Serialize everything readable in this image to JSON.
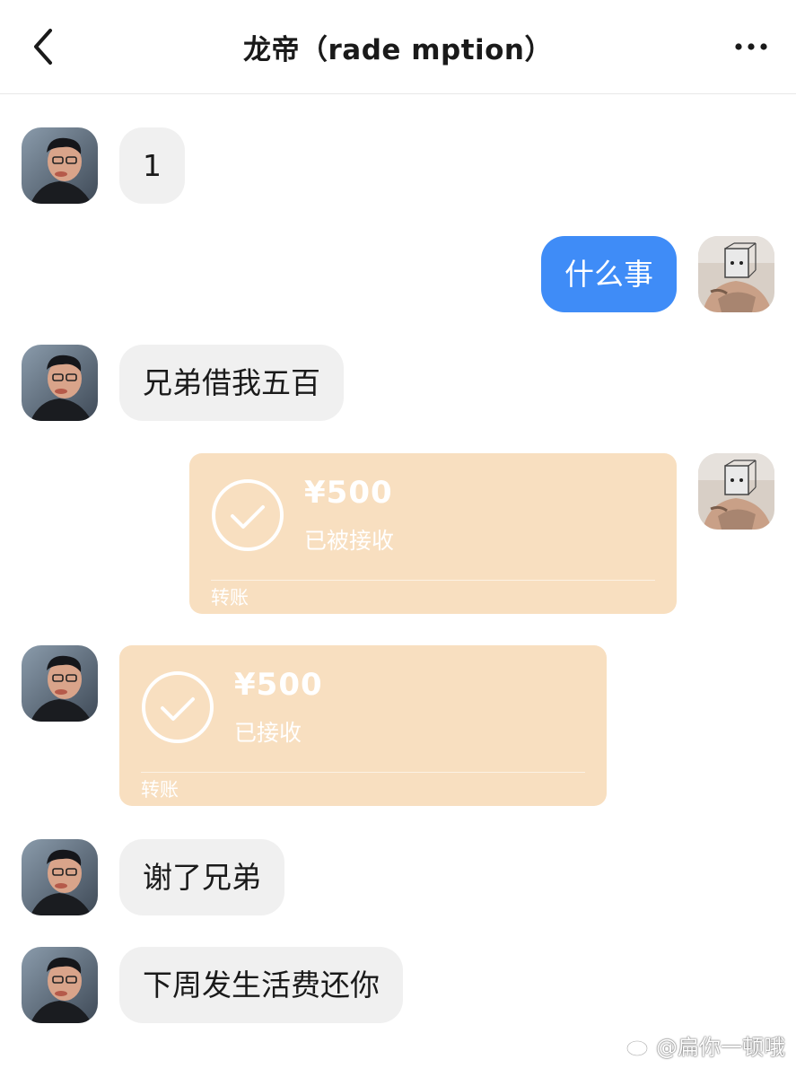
{
  "header": {
    "title": "龙帝（rade mption）",
    "back_icon": "chevron-left-icon",
    "more_icon": "more-horizontal-icon"
  },
  "messages": [
    {
      "side": "in",
      "kind": "text",
      "text": "1"
    },
    {
      "side": "out",
      "kind": "text",
      "text": "什么事"
    },
    {
      "side": "in",
      "kind": "text",
      "text": "兄弟借我五百"
    },
    {
      "side": "out",
      "kind": "transfer",
      "amount": "¥500",
      "status": "已被接收",
      "label": "转账"
    },
    {
      "side": "in",
      "kind": "transfer",
      "amount": "¥500",
      "status": "已接收",
      "label": "转账"
    },
    {
      "side": "in",
      "kind": "text",
      "text": "谢了兄弟"
    },
    {
      "side": "in",
      "kind": "text",
      "text": "下周发生活费还你"
    }
  ],
  "watermark": {
    "text": "@扁你一顿哦",
    "icon": "weibo-icon"
  },
  "colors": {
    "outgoing_bubble": "#3f8cf7",
    "incoming_bubble": "#f0f0f0",
    "transfer_card": "#f8dfc0"
  }
}
